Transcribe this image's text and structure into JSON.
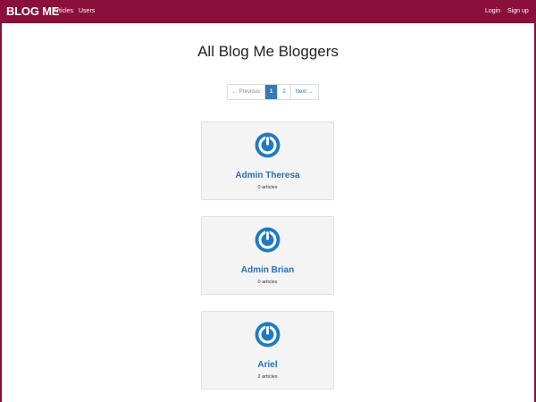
{
  "navbar": {
    "brand": "BLOG ME",
    "links": [
      "Articles",
      "Users"
    ],
    "right_links": [
      "Login",
      "Sign up"
    ]
  },
  "page": {
    "title": "All Blog Me Bloggers"
  },
  "pagination": {
    "previous": "← Previous",
    "pages": [
      "1",
      "2"
    ],
    "active_page": "1",
    "next": "Next →"
  },
  "users": [
    {
      "name": "Admin Theresa",
      "articles": "0 articles",
      "avatar_icon": "power-icon"
    },
    {
      "name": "Admin Brian",
      "articles": "0 articles",
      "avatar_icon": "power-icon"
    },
    {
      "name": "Ariel",
      "articles": "2 articles",
      "avatar_icon": "power-icon"
    }
  ],
  "colors": {
    "brand": "#8a0f3a",
    "link": "#2a6fb6",
    "active_page": "#337ab7",
    "card_bg": "#f4f4f4"
  }
}
